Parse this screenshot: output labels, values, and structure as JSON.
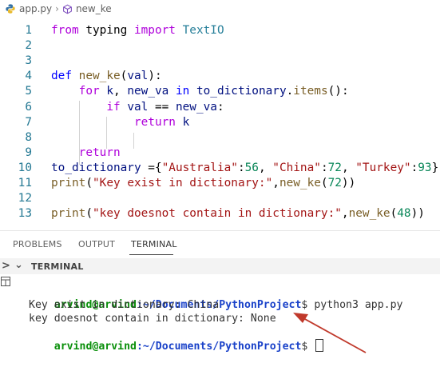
{
  "breadcrumb": {
    "file": "app.py",
    "symbol": "new_ke"
  },
  "editor": {
    "lines": [
      {
        "n": "1",
        "html": "<span class=\"kw2\">from</span> typing <span class=\"kw2\">import</span> <span class=\"cls\">TextIO</span>"
      },
      {
        "n": "2",
        "html": ""
      },
      {
        "n": "3",
        "html": ""
      },
      {
        "n": "4",
        "html": "<span class=\"kw\">def</span> <span class=\"fn\">new_ke</span>(<span class=\"pa\">val</span>):"
      },
      {
        "n": "5",
        "html": "    <span class=\"kw2\">for</span> <span class=\"pa\">k</span>, <span class=\"pa\">new_va</span> <span class=\"kw\">in</span> <span class=\"pa\">to_dictionary</span>.<span class=\"fn\">items</span>():"
      },
      {
        "n": "6",
        "html": "        <span class=\"kw2\">if</span> <span class=\"pa\">val</span> == <span class=\"pa\">new_va</span>:"
      },
      {
        "n": "7",
        "html": "            <span class=\"kw2\">return</span> <span class=\"pa\">k</span>"
      },
      {
        "n": "8",
        "html": ""
      },
      {
        "n": "9",
        "html": "    <span class=\"kw2\">return</span>"
      },
      {
        "n": "10",
        "html": "<span class=\"pa\">to_dictionary</span> ={<span class=\"str\">\"Australia\"</span>:<span class=\"num\">56</span>, <span class=\"str\">\"China\"</span>:<span class=\"num\">72</span>, <span class=\"str\">\"Turkey\"</span>:<span class=\"num\">93</span>}"
      },
      {
        "n": "11",
        "html": "<span class=\"fn\">print</span>(<span class=\"str\">\"Key exist in dictionary:\"</span>,<span class=\"fn\">new_ke</span>(<span class=\"num\">72</span>))"
      },
      {
        "n": "12",
        "html": ""
      },
      {
        "n": "13",
        "html": "<span class=\"fn\">print</span>(<span class=\"str\">\"key doesnot contain in dictionary:\"</span>,<span class=\"fn\">new_ke</span>(<span class=\"num\">48</span>))"
      }
    ],
    "colors": {
      "keyword": "#0000ff",
      "control": "#af00db",
      "function": "#795e26",
      "string": "#a31515",
      "number": "#098658"
    }
  },
  "panel": {
    "tabs": [
      "PROBLEMS",
      "OUTPUT",
      "TERMINAL"
    ],
    "active_tab": "TERMINAL",
    "section_title": "TERMINAL"
  },
  "terminal": {
    "prompt_user": "arvind@arvind",
    "prompt_path": ":~/Documents/PythonProject",
    "prompt_symbol": "$",
    "command": " python3 app.py",
    "output1": "Key exist in dictionary: China",
    "output2": "key doesnot contain in dictionary: None",
    "annotation_color": "#c0392b"
  }
}
